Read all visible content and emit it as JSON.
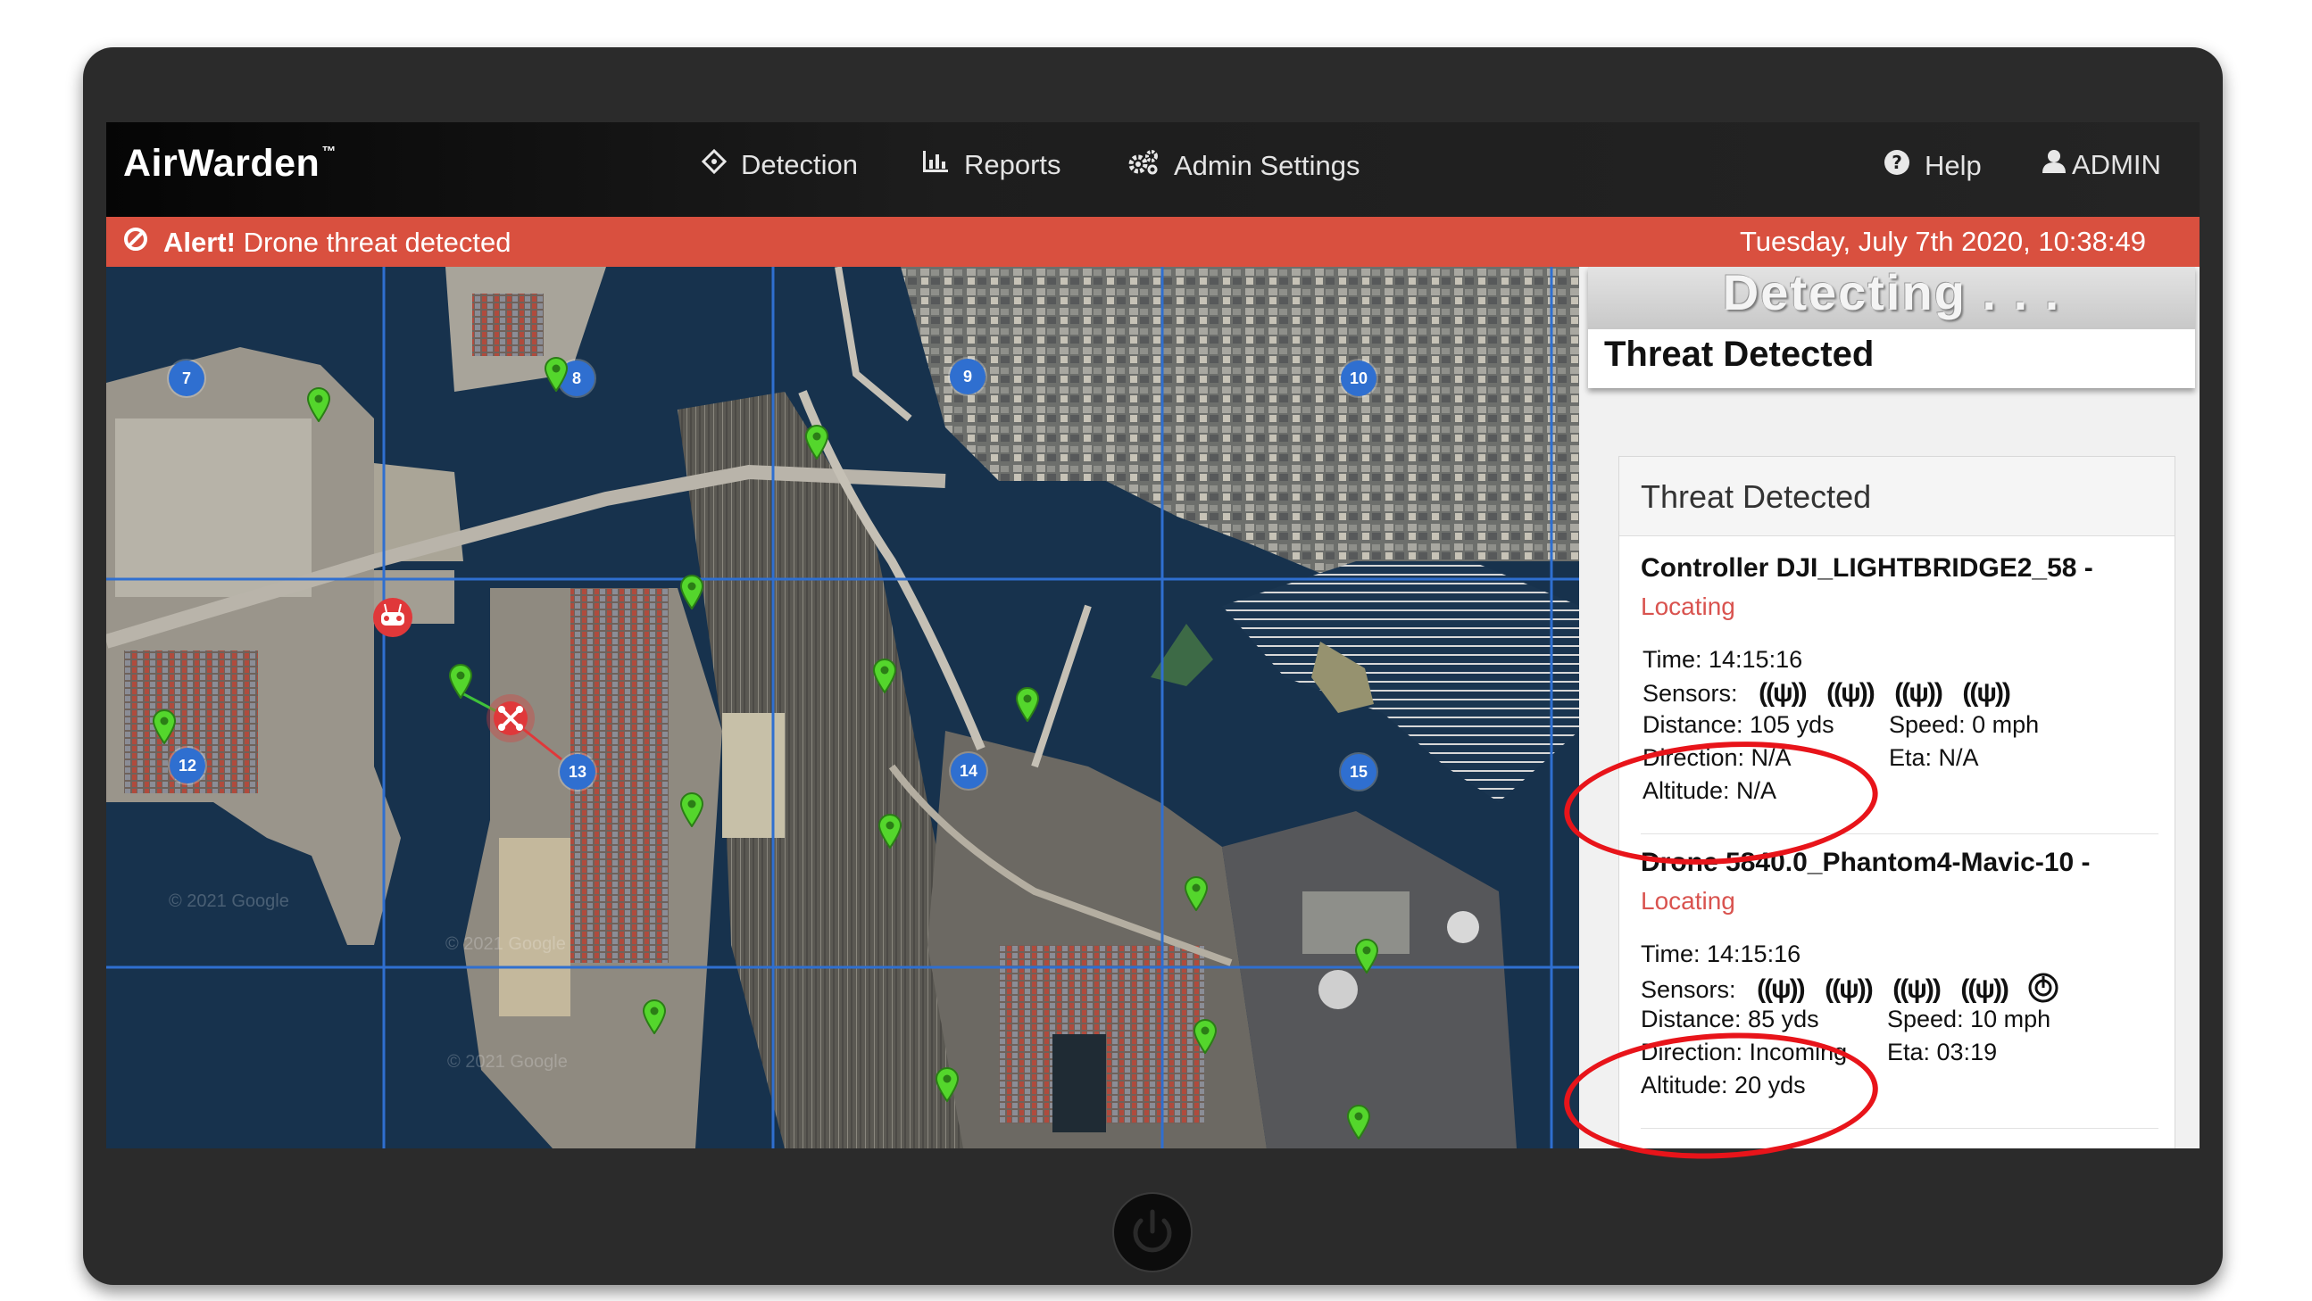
{
  "app": {
    "brand": "AirWarden",
    "trademark": "™"
  },
  "nav": {
    "items": [
      {
        "label": "Detection",
        "icon": "crosshair-icon"
      },
      {
        "label": "Reports",
        "icon": "bar-chart-icon"
      },
      {
        "label": "Admin Settings",
        "icon": "gears-icon"
      }
    ],
    "help": "Help",
    "user": "ADMIN"
  },
  "alert": {
    "strong": "Alert!",
    "message": "Drone threat detected",
    "timestamp": "Tuesday, July 7th 2020, 10:38:49",
    "color": "#d9503f"
  },
  "map": {
    "sectors": [
      "7",
      "8",
      "9",
      "10",
      "12",
      "13",
      "14",
      "15"
    ],
    "watermark": "© 2021 Google",
    "pin_color": "#54d62c",
    "threat_color": "#e0383a"
  },
  "panel": {
    "detecting_title": "Detecting . . .",
    "detecting_subtitle": "Threat Detected",
    "card_title": "Threat Detected",
    "entries": [
      {
        "title": "Controller DJI_LIGHTBRIDGE2_58 -",
        "status": "Locating",
        "time": "Time: 14:15:16",
        "sensors_label": "Sensors:",
        "distance": "Distance: 105 yds",
        "speed": "Speed: 0 mph",
        "direction": "Direction: N/A",
        "eta": "Eta: N/A",
        "altitude": "Altitude: N/A"
      },
      {
        "title": "Drone 5840.0_Phantom4-Mavic-10 -",
        "status": "Locating",
        "time": "Time: 14:15:16",
        "sensors_label": "Sensors:",
        "distance": "Distance: 85 yds",
        "speed": "Speed: 10 mph",
        "direction": "Direction: Incoming",
        "eta": "Eta: 03:19",
        "altitude": "Altitude: 20 yds"
      }
    ],
    "status_color": "#d9534f",
    "highlight_color": "#e8141a"
  }
}
